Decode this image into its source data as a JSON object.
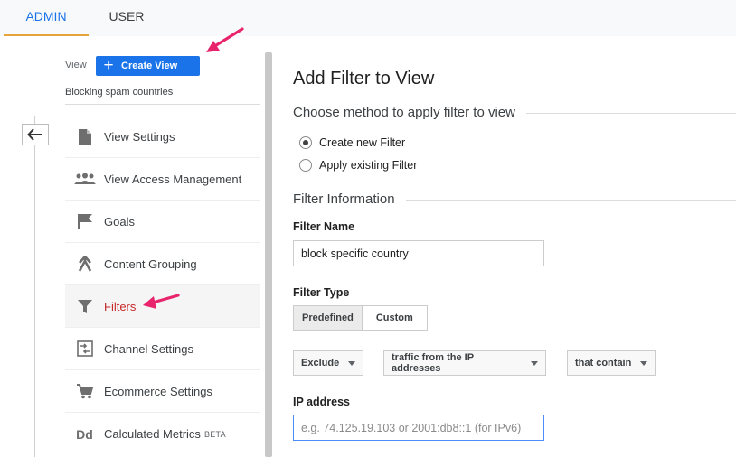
{
  "tabs": [
    {
      "label": "ADMIN"
    },
    {
      "label": "USER"
    }
  ],
  "sidebar": {
    "view_label": "View",
    "create_view_label": "Create View",
    "view_name": "Blocking spam countries",
    "items": [
      {
        "label": "View Settings",
        "icon": "document-icon"
      },
      {
        "label": "View Access Management",
        "icon": "people-icon"
      },
      {
        "label": "Goals",
        "icon": "flag-icon"
      },
      {
        "label": "Content Grouping",
        "icon": "content-grouping-icon"
      },
      {
        "label": "Filters",
        "icon": "filter-icon"
      },
      {
        "label": "Channel Settings",
        "icon": "channel-settings-icon"
      },
      {
        "label": "Ecommerce Settings",
        "icon": "cart-icon"
      },
      {
        "label": "Calculated Metrics",
        "icon": "dd-icon",
        "icon_text": "Dd",
        "badge": "BETA"
      }
    ]
  },
  "main": {
    "title": "Add Filter to View",
    "method_heading": "Choose method to apply filter to view",
    "method_options": [
      {
        "label": "Create new Filter"
      },
      {
        "label": "Apply existing Filter"
      }
    ],
    "info_heading": "Filter Information",
    "filter_name_label": "Filter Name",
    "filter_name_value": "block specific country",
    "filter_type_label": "Filter Type",
    "type_options": [
      {
        "label": "Predefined"
      },
      {
        "label": "Custom"
      }
    ],
    "dropdowns": [
      {
        "value": "Exclude"
      },
      {
        "value": "traffic from the IP addresses"
      },
      {
        "value": "that contain"
      }
    ],
    "ip_label": "IP address",
    "ip_placeholder": "e.g. 74.125.19.103 or 2001:db8::1 (for IPv6)"
  },
  "colors": {
    "accent": "#1a73e8",
    "active_nav": "#c62828",
    "annotation_arrow": "#e8246d"
  }
}
